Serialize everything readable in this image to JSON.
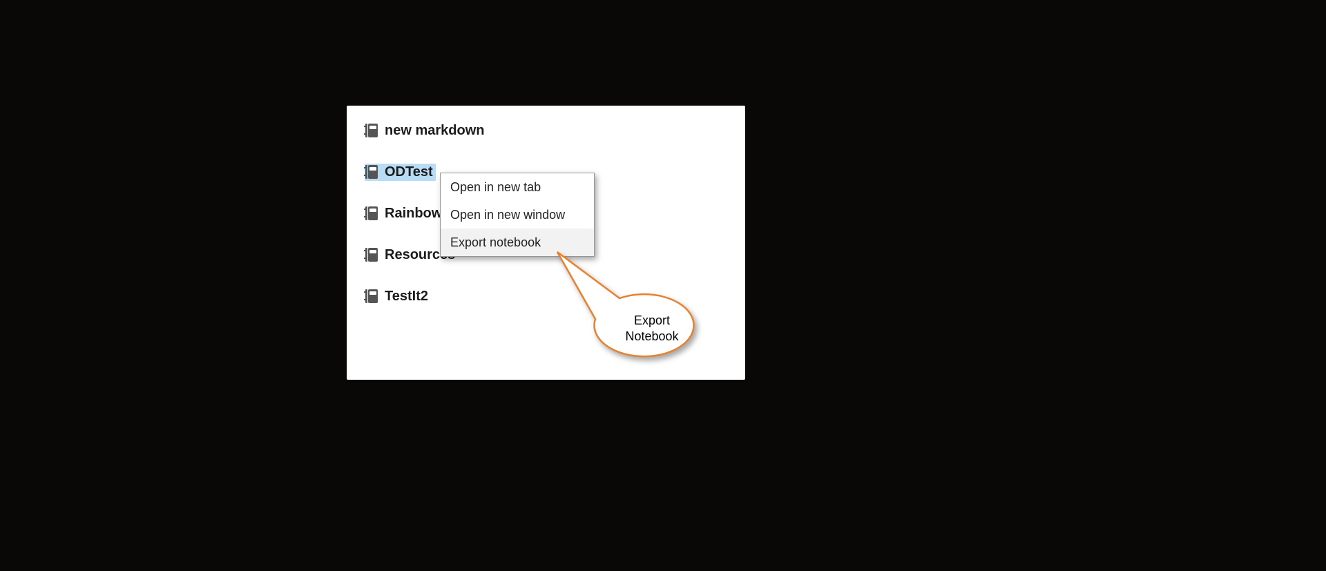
{
  "notebooks": {
    "items": [
      {
        "label": "new markdown",
        "selected": false
      },
      {
        "label": "ODTest",
        "selected": true
      },
      {
        "label": "Rainbow",
        "selected": false
      },
      {
        "label": "Resources",
        "selected": false
      },
      {
        "label": "TestIt2",
        "selected": false
      }
    ]
  },
  "context_menu": {
    "items": [
      {
        "label": "Open in new tab",
        "hovered": false
      },
      {
        "label": "Open in new window",
        "hovered": false
      },
      {
        "label": "Export notebook",
        "hovered": true
      }
    ]
  },
  "callout": {
    "line1": "Export",
    "line2": "Notebook"
  },
  "colors": {
    "selection_bg": "#b9dcf5",
    "callout_stroke": "#e8812c"
  }
}
